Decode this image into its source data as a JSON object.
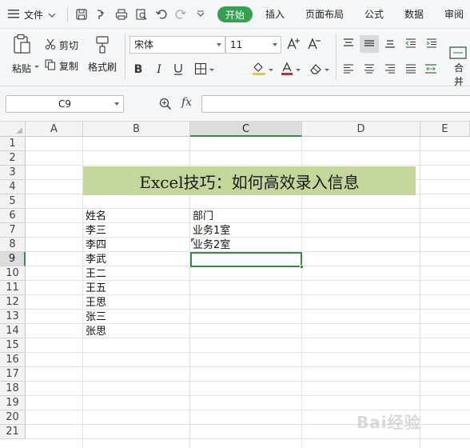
{
  "menu": {
    "file_label": "文件",
    "tabs": [
      "开始",
      "插入",
      "页面布局",
      "公式",
      "数据",
      "审阅"
    ],
    "active_tab": "开始"
  },
  "ribbon": {
    "paste": "粘贴",
    "cut": "剪切",
    "copy": "复制",
    "format_painter": "格式刷",
    "font_name": "宋体",
    "font_size": "11",
    "merge": "合并"
  },
  "formula_bar": {
    "name_box": "C9",
    "fx_label": "fx",
    "formula": ""
  },
  "sheet": {
    "columns": [
      "A",
      "B",
      "C",
      "D",
      "E"
    ],
    "selected_column": "C",
    "rows": [
      "1",
      "2",
      "3",
      "4",
      "5",
      "6",
      "7",
      "8",
      "9",
      "10",
      "11",
      "12",
      "13",
      "14",
      "15",
      "16",
      "17",
      "18",
      "19",
      "20",
      "21"
    ],
    "selected_row": "9",
    "title": "Excel技巧：如何高效录入信息",
    "header_b": "姓名",
    "header_c": "部门",
    "names": [
      "李三",
      "李四",
      "李武",
      "王二",
      "王五",
      "王思",
      "张三",
      "张思"
    ],
    "departments": [
      "业务1室",
      "业务2室"
    ]
  },
  "colors": {
    "accent": "#35a150",
    "title_fill": "#c4d79b",
    "selection": "#3a8b45"
  },
  "watermark": "Bai经验"
}
